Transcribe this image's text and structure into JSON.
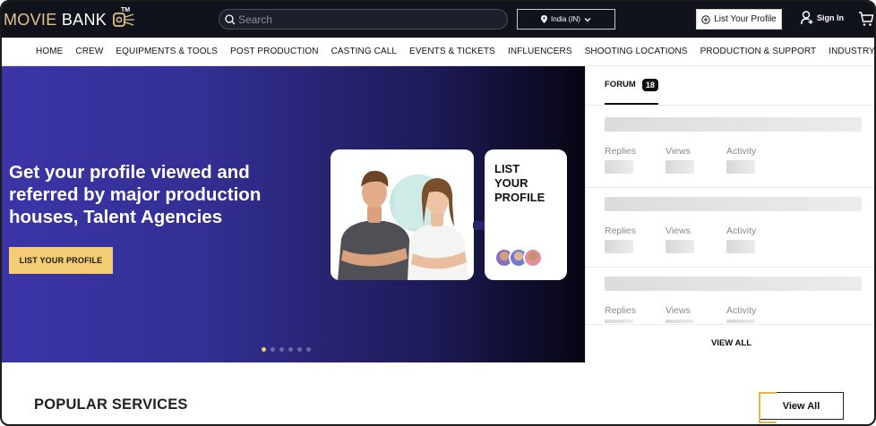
{
  "brand": {
    "name_part1": "MOVIE",
    "name_part2": "BANK",
    "tm": "TM"
  },
  "search": {
    "placeholder": "Search",
    "value": ""
  },
  "location": {
    "label": "India (IN)"
  },
  "header": {
    "list_profile_label": "List Your Profile",
    "signin_label": "Sign In"
  },
  "nav": {
    "items": [
      {
        "label": "HOME"
      },
      {
        "label": "CREW"
      },
      {
        "label": "EQUIPMENTS & TOOLS"
      },
      {
        "label": "POST PRODUCTION"
      },
      {
        "label": "CASTING CALL"
      },
      {
        "label": "EVENTS & TICKETS"
      },
      {
        "label": "INFLUENCERS"
      },
      {
        "label": "SHOOTING LOCATIONS"
      },
      {
        "label": "PRODUCTION & SUPPORT"
      },
      {
        "label": "INDUSTRY JOBS"
      }
    ]
  },
  "hero": {
    "title": "Get your profile viewed and referred by major production houses, Talent Agencies",
    "cta_label": "LIST YOUR PROFILE",
    "card_label_line1": "LIST",
    "card_label_line2": "YOUR",
    "card_label_line3": "PROFILE",
    "slide_count": 6,
    "active_slide": 1
  },
  "forum": {
    "tab_label": "FORUM",
    "count": "18",
    "stat_labels": {
      "replies": "Replies",
      "views": "Views",
      "activity": "Activity"
    },
    "view_all_label": "VIEW ALL"
  },
  "popular": {
    "title": "POPULAR SERVICES",
    "view_all_label": "View All"
  },
  "colors": {
    "topbar_bg": "#11131c",
    "accent_gold": "#f3cc73",
    "hero_gradient_start": "#3b35a8",
    "hero_gradient_end": "#060512"
  },
  "icons": [
    "search-icon",
    "location-pin-icon",
    "chevron-down-icon",
    "plus-circle-icon",
    "user-add-icon",
    "cart-icon"
  ]
}
